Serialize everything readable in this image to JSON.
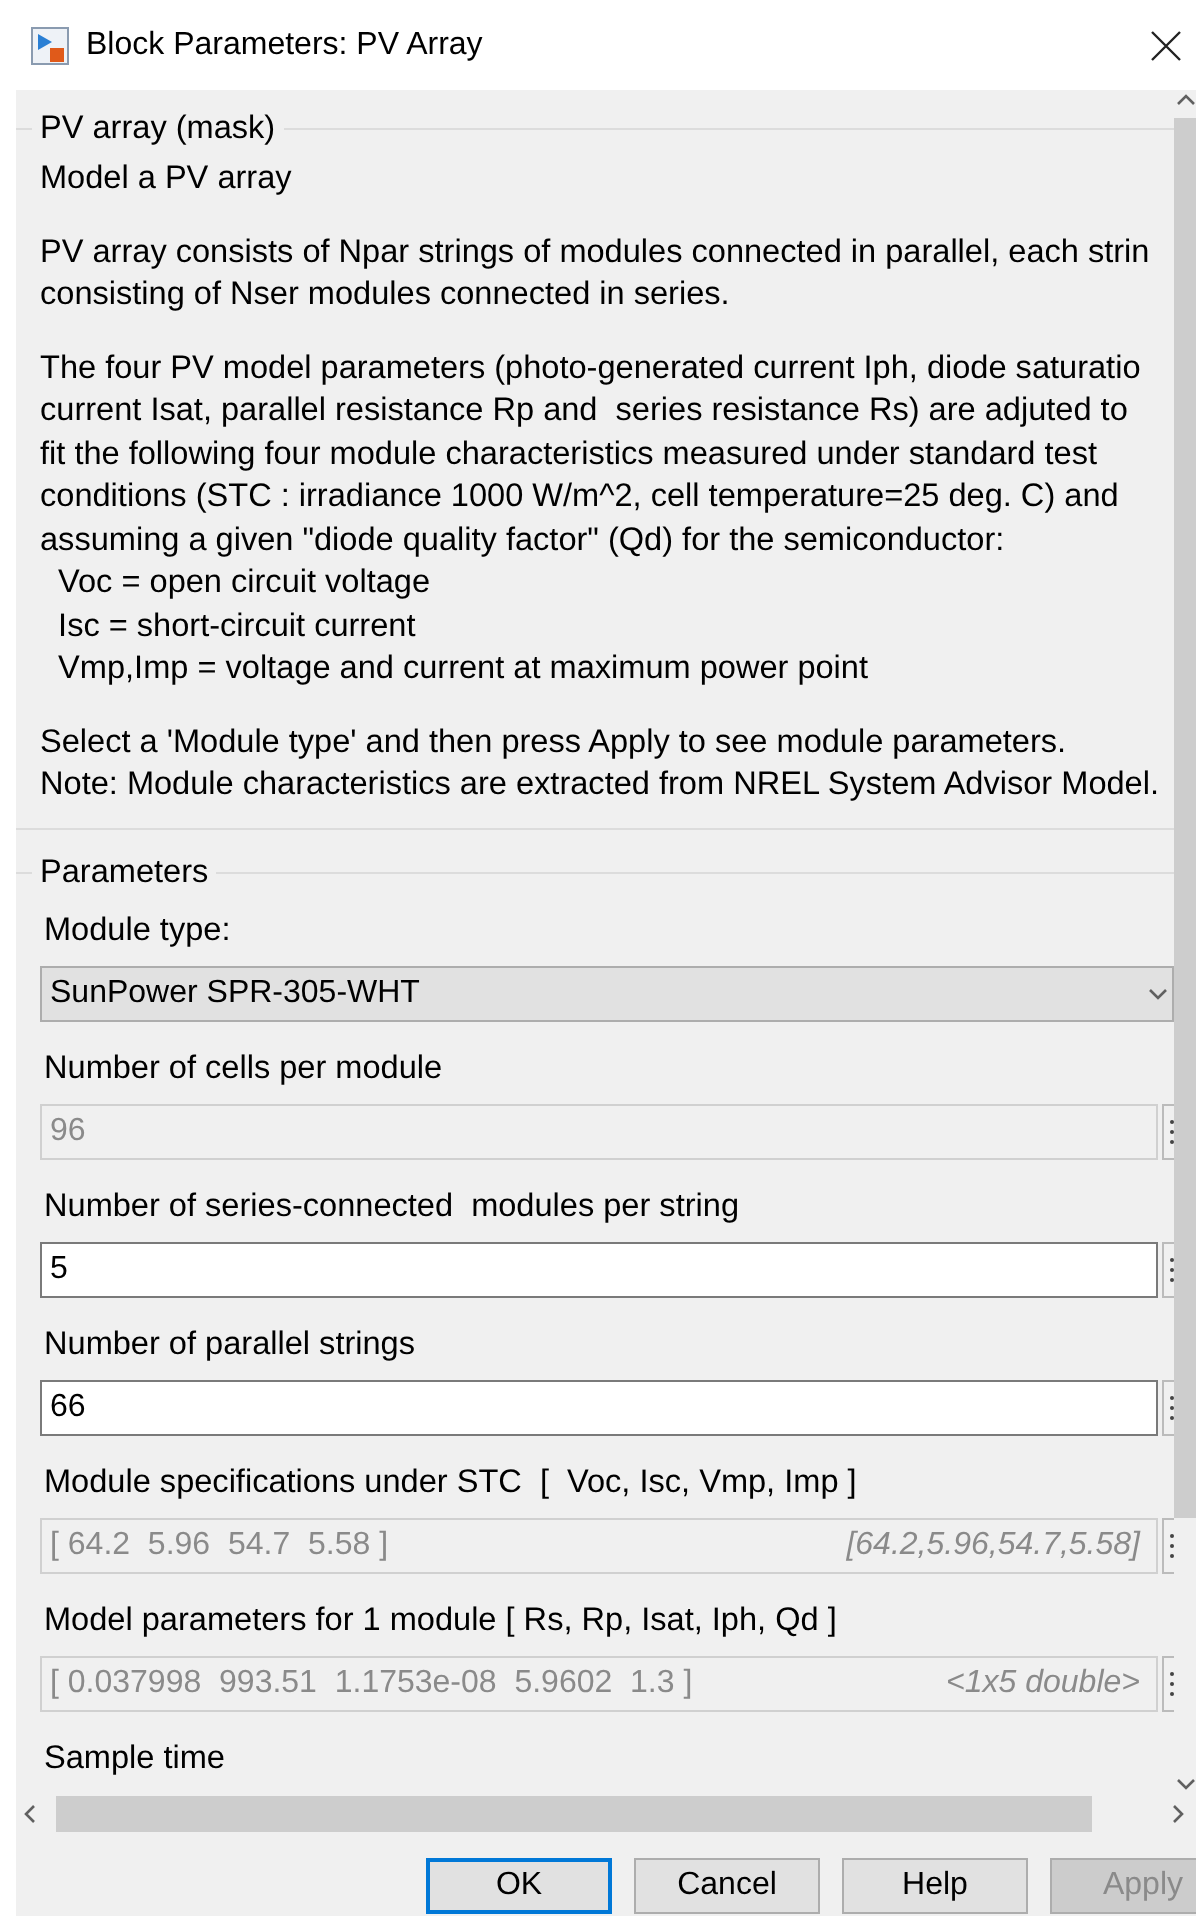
{
  "window": {
    "title": "Block Parameters: PV Array"
  },
  "description": {
    "title": "PV array (mask)",
    "paragraphs": [
      [
        "Model a PV array"
      ],
      [
        "PV array consists of Npar strings of modules connected in parallel, each strin",
        "consisting of Nser modules connected in series."
      ],
      [
        "The four PV model parameters (photo-generated current Iph, diode saturatio",
        "current Isat, parallel resistance Rp and  series resistance Rs) are adjuted to",
        "fit the following four module characteristics measured under standard test",
        "conditions (STC : irradiance 1000 W/m^2, cell temperature=25 deg. C) and",
        "assuming a given \"diode quality factor\" (Qd) for the semiconductor:",
        "  Voc = open circuit voltage",
        "  Isc = short-circuit current",
        "  Vmp,Imp = voltage and current at maximum power point"
      ],
      [
        "Select a 'Module type' and then press Apply to see module parameters.",
        "Note: Module characteristics are extracted from NREL System Advisor Model."
      ]
    ]
  },
  "parameters": {
    "title": "Parameters",
    "fields": [
      {
        "kind": "dropdown",
        "label": "Module type:",
        "value": "SunPower SPR-305-WHT"
      },
      {
        "kind": "edit",
        "label": "Number of cells per module",
        "value": "96",
        "disabled": true
      },
      {
        "kind": "edit",
        "label": "Number of series-connected  modules per string",
        "value": "5",
        "disabled": false
      },
      {
        "kind": "edit",
        "label": "Number of parallel strings",
        "value": "66",
        "disabled": false
      },
      {
        "kind": "edit",
        "label": "Module specifications under STC  [  Voc, Isc, Vmp, Imp ]",
        "value": "[ 64.2  5.96  54.7  5.58 ]",
        "hint": "[64.2,5.96,54.7,5.58]",
        "disabled": true
      },
      {
        "kind": "edit",
        "label": "Model parameters for 1 module [ Rs, Rp, Isat, Iph, Qd ]",
        "value": "[ 0.037998  993.51  1.1753e-08  5.9602  1.3 ]",
        "hint": "<1x5 double>",
        "disabled": true
      },
      {
        "kind": "label",
        "label": "Sample time"
      }
    ]
  },
  "buttons": [
    {
      "label": "OK",
      "default": true,
      "disabled": false
    },
    {
      "label": "Cancel",
      "default": false,
      "disabled": false
    },
    {
      "label": "Help",
      "default": false,
      "disabled": false
    },
    {
      "label": "Apply",
      "default": false,
      "disabled": true
    }
  ]
}
